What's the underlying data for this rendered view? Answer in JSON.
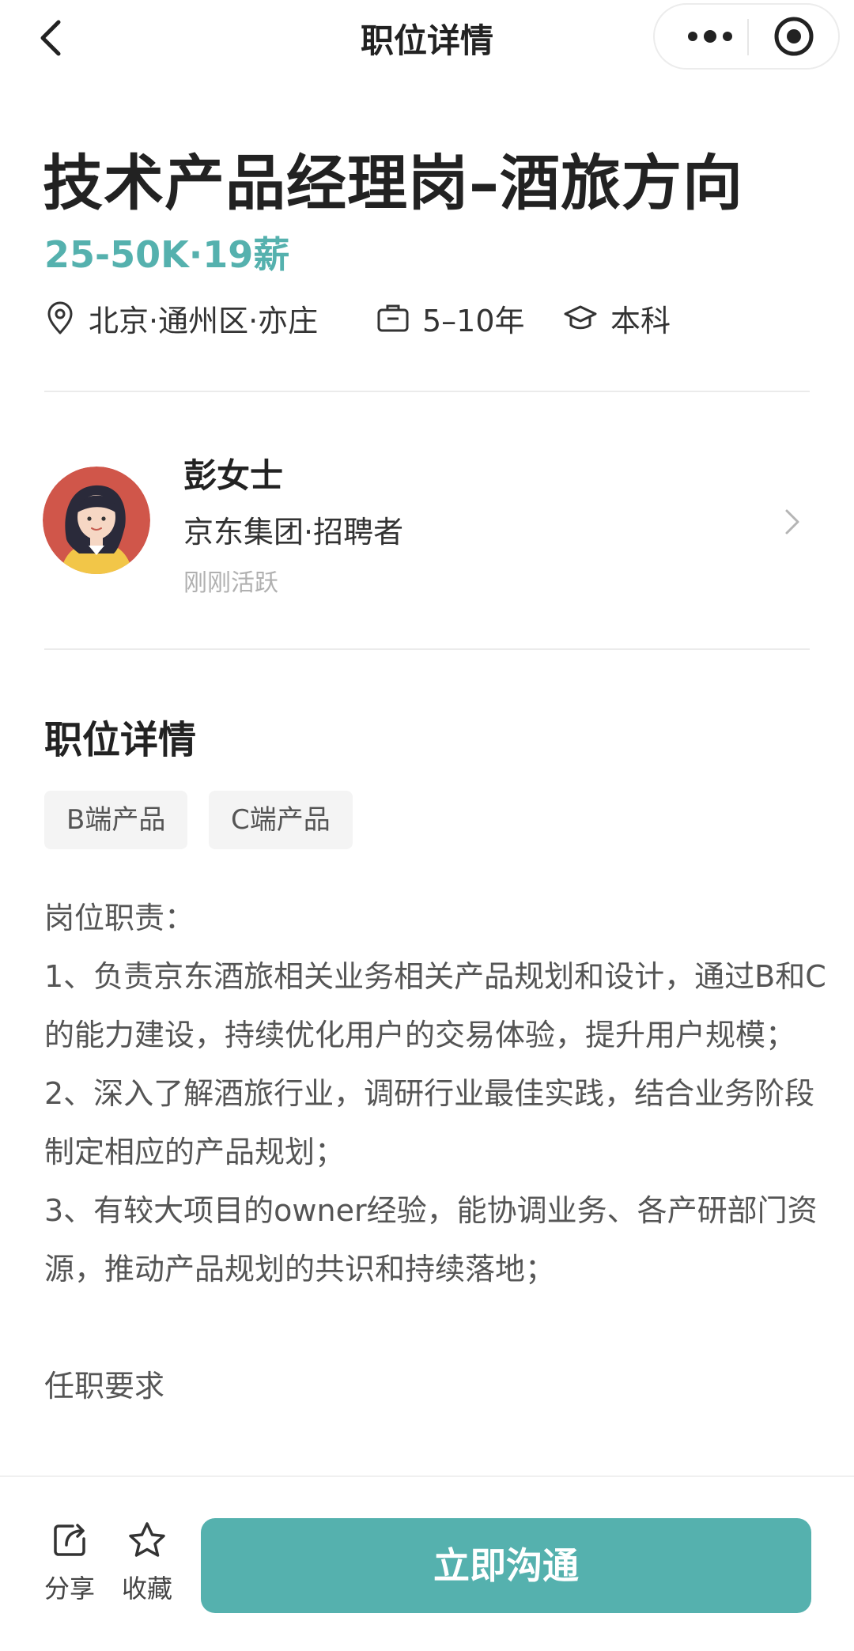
{
  "navbar": {
    "title": "职位详情",
    "back_icon": "chevron-left-icon",
    "more_icon": "more-dots-icon",
    "close_icon": "target-circle-icon"
  },
  "job": {
    "title": "技术产品经理岗–酒旅方向",
    "salary": "25-50K·19薪",
    "location": "北京·通州区·亦庄",
    "experience": "5–10年",
    "education": "本科"
  },
  "recruiter": {
    "name": "彭女士",
    "company_role": "京东集团·招聘者",
    "active_status": "刚刚活跃"
  },
  "details": {
    "section_title": "职位详情",
    "tags": [
      "B端产品",
      "C端产品"
    ],
    "lines": [
      "岗位职责：",
      "1、负责京东酒旅相关业务相关产品规划和设计，通过B和C的能力建设，持续优化用户的交易体验，提升用户规模；",
      "2、深入了解酒旅行业，调研行业最佳实践，结合业务阶段制定相应的产品规划；",
      "3、有较大项目的owner经验，能协调业务、各产研部门资源，推动产品规划的共识和持续落地；",
      "",
      "任职要求"
    ]
  },
  "bottom_bar": {
    "share_label": "分享",
    "favorite_label": "收藏",
    "chat_button": "立即沟通"
  },
  "colors": {
    "accent": "#55b1ae",
    "text_primary": "#222222",
    "text_secondary": "#555555",
    "text_muted": "#b0b0b0",
    "tag_bg": "#f4f4f4"
  }
}
